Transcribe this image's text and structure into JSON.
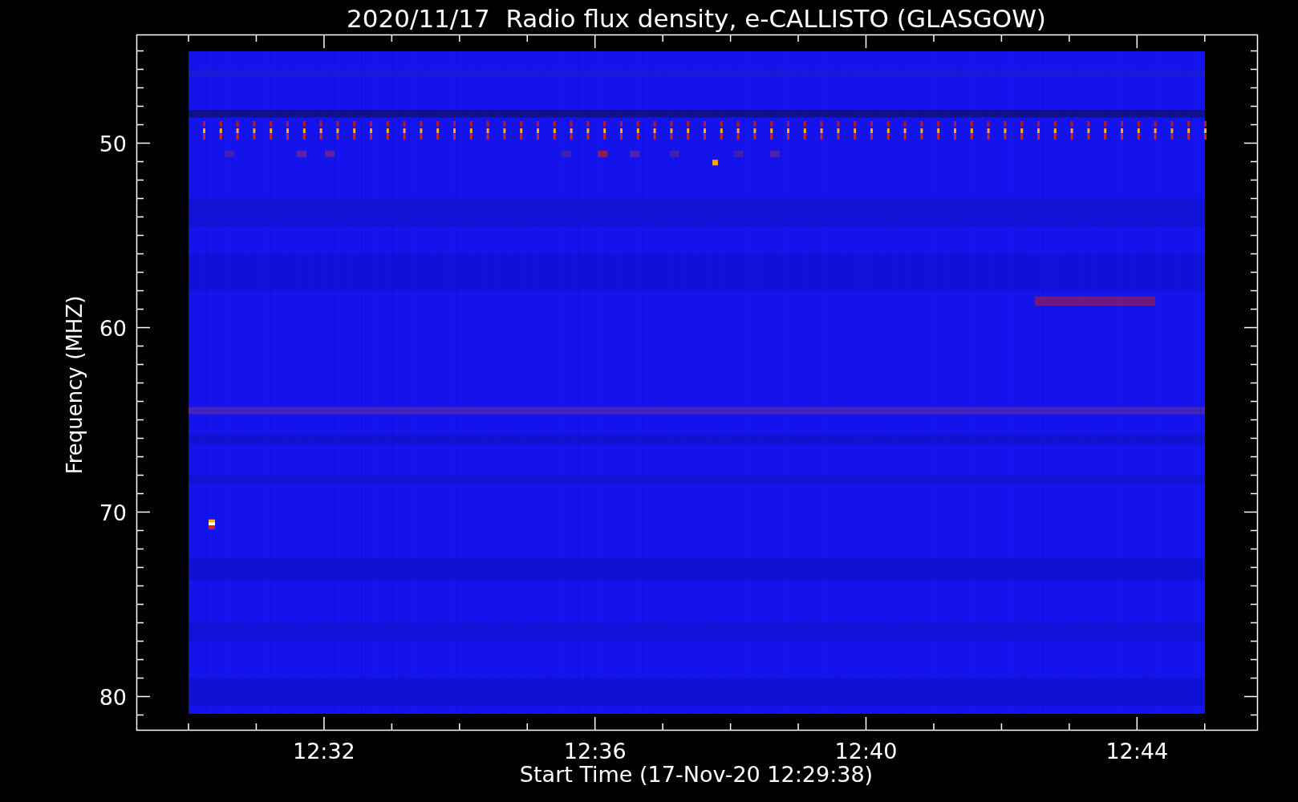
{
  "title": "2020/11/17  Radio flux density, e-CALLISTO (GLASGOW)",
  "y_axis": {
    "label": "Frequency (MHZ)",
    "ticks": [
      "50",
      "60",
      "70",
      "80"
    ]
  },
  "x_axis": {
    "label": "Start Time (17-Nov-20 12:29:38)",
    "ticks": [
      "12:32",
      "12:36",
      "12:40",
      "12:44"
    ]
  }
}
